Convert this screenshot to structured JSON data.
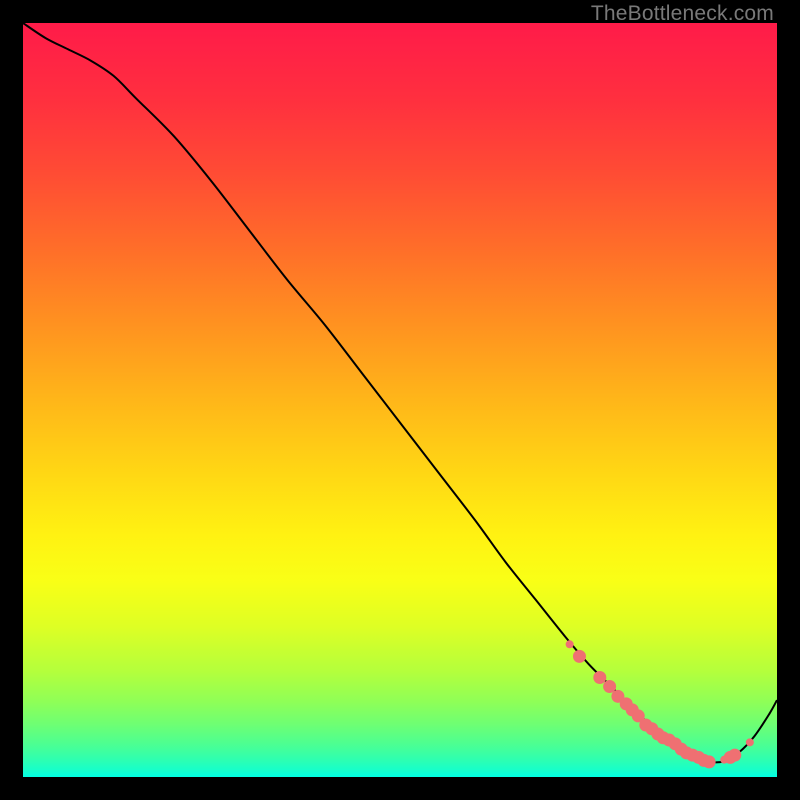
{
  "watermark": "TheBottleneck.com",
  "chart_data": {
    "type": "line",
    "title": "",
    "xlabel": "",
    "ylabel": "",
    "xlim": [
      0,
      100
    ],
    "ylim": [
      0,
      100
    ],
    "background_gradient_stops": [
      {
        "offset": 0.0,
        "color": "#ff1b49"
      },
      {
        "offset": 0.1,
        "color": "#ff2f3f"
      },
      {
        "offset": 0.2,
        "color": "#ff4c34"
      },
      {
        "offset": 0.3,
        "color": "#ff6e29"
      },
      {
        "offset": 0.4,
        "color": "#ff9220"
      },
      {
        "offset": 0.5,
        "color": "#ffb619"
      },
      {
        "offset": 0.6,
        "color": "#ffd814"
      },
      {
        "offset": 0.68,
        "color": "#fff212"
      },
      {
        "offset": 0.74,
        "color": "#f9ff16"
      },
      {
        "offset": 0.8,
        "color": "#deff24"
      },
      {
        "offset": 0.86,
        "color": "#b4ff3c"
      },
      {
        "offset": 0.9,
        "color": "#8fff57"
      },
      {
        "offset": 0.93,
        "color": "#6eff73"
      },
      {
        "offset": 0.955,
        "color": "#4eff90"
      },
      {
        "offset": 0.975,
        "color": "#31ffad"
      },
      {
        "offset": 0.99,
        "color": "#18ffc9"
      },
      {
        "offset": 1.0,
        "color": "#02ffe4"
      }
    ],
    "series": [
      {
        "name": "bottleneck-curve",
        "x": [
          0,
          3,
          6,
          9,
          12,
          15,
          20,
          25,
          30,
          35,
          40,
          45,
          50,
          55,
          60,
          64,
          68,
          72,
          75,
          78,
          81,
          83,
          85,
          87,
          89,
          91,
          93,
          95,
          97,
          99,
          100
        ],
        "y": [
          100,
          98,
          96.5,
          95,
          93,
          90,
          85,
          79,
          72.5,
          66,
          60,
          53.5,
          47,
          40.5,
          34,
          28.5,
          23.5,
          18.5,
          15,
          12,
          9,
          7,
          5.2,
          3.8,
          2.7,
          2.0,
          2.1,
          3.3,
          5.4,
          8.4,
          10.2
        ],
        "color": "#000000",
        "stroke_width": 2
      }
    ],
    "markers": {
      "name": "highlight-cluster",
      "color": "#ef7072",
      "radius_small": 4,
      "radius_large": 6.5,
      "points": [
        {
          "x": 72.5,
          "y": 17.6,
          "r": "small"
        },
        {
          "x": 73.8,
          "y": 16.0,
          "r": "large"
        },
        {
          "x": 76.5,
          "y": 13.2,
          "r": "large"
        },
        {
          "x": 77.8,
          "y": 12.0,
          "r": "large"
        },
        {
          "x": 78.9,
          "y": 10.7,
          "r": "large"
        },
        {
          "x": 80.0,
          "y": 9.7,
          "r": "large"
        },
        {
          "x": 80.8,
          "y": 8.9,
          "r": "large"
        },
        {
          "x": 81.6,
          "y": 8.1,
          "r": "large"
        },
        {
          "x": 82.6,
          "y": 6.9,
          "r": "large"
        },
        {
          "x": 83.4,
          "y": 6.4,
          "r": "large"
        },
        {
          "x": 84.2,
          "y": 5.7,
          "r": "large"
        },
        {
          "x": 84.9,
          "y": 5.2,
          "r": "large"
        },
        {
          "x": 85.7,
          "y": 4.9,
          "r": "large"
        },
        {
          "x": 86.5,
          "y": 4.4,
          "r": "large"
        },
        {
          "x": 87.3,
          "y": 3.7,
          "r": "large"
        },
        {
          "x": 88.0,
          "y": 3.2,
          "r": "large"
        },
        {
          "x": 88.8,
          "y": 2.9,
          "r": "large"
        },
        {
          "x": 89.6,
          "y": 2.6,
          "r": "large"
        },
        {
          "x": 90.3,
          "y": 2.2,
          "r": "large"
        },
        {
          "x": 91.0,
          "y": 2.0,
          "r": "large"
        },
        {
          "x": 93.0,
          "y": 2.3,
          "r": "small"
        },
        {
          "x": 93.8,
          "y": 2.6,
          "r": "large"
        },
        {
          "x": 94.4,
          "y": 2.9,
          "r": "large"
        },
        {
          "x": 96.4,
          "y": 4.6,
          "r": "small"
        }
      ]
    }
  }
}
